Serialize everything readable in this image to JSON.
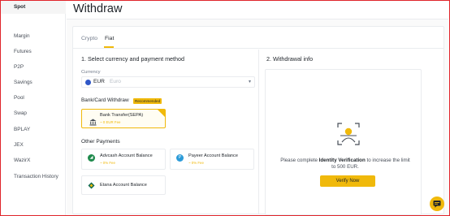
{
  "sidebar": {
    "items": [
      {
        "label": "Spot",
        "active": true
      },
      {
        "label": "Margin"
      },
      {
        "label": "Futures"
      },
      {
        "label": "P2P"
      },
      {
        "label": "Savings"
      },
      {
        "label": "Pool"
      },
      {
        "label": "Swap"
      },
      {
        "label": "BPLAY"
      },
      {
        "label": "JEX"
      },
      {
        "label": "WazirX"
      },
      {
        "label": "Transaction History"
      }
    ]
  },
  "header": {
    "title": "Withdraw"
  },
  "tabs": [
    {
      "label": "Crypto"
    },
    {
      "label": "Fiat",
      "active": true
    }
  ],
  "step1": {
    "title": "1. Select currency and payment method",
    "currency_label": "Currency",
    "currency_code": "EUR",
    "currency_name": "Euro"
  },
  "bank_card": {
    "title": "Bank/Card Withdraw",
    "badge": "Recommended",
    "options": [
      {
        "name": "Bank Transfer(SEPA)",
        "fee": "~ 0 EUR Fee",
        "selected": true
      }
    ]
  },
  "other_payments": {
    "title": "Other Payments",
    "options": [
      {
        "name": "Advcash Account Balance",
        "fee": "~ 0% Fee",
        "icon": "advcash-icon"
      },
      {
        "name": "Payeer Account Balance",
        "fee": "~ 0% Fee",
        "icon": "payeer-icon",
        "icon_letter": "P"
      },
      {
        "name": "Etana Account Balance",
        "icon": "etana-icon"
      }
    ]
  },
  "step2": {
    "title": "2. Withdrawal info",
    "message_prefix": "Please complete ",
    "message_bold": "Identity Verification",
    "message_suffix": " to increase the limit to 500 EUR.",
    "button": "Verify Now"
  },
  "colors": {
    "accent": "#f0b90b",
    "text": "#1e2329",
    "muted": "#707a8a",
    "border": "#eaecef",
    "frame": "#e0252b"
  }
}
